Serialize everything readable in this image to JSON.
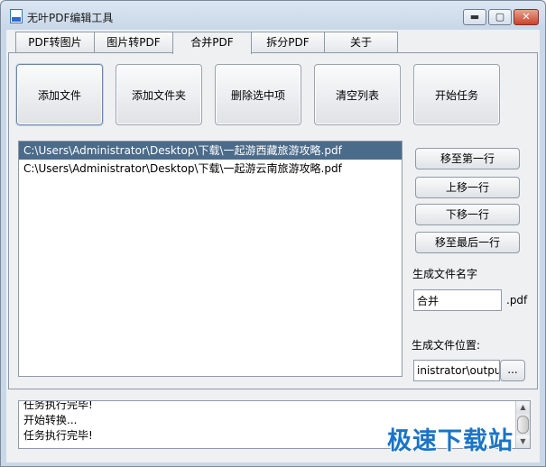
{
  "window": {
    "title": "无叶PDF编辑工具",
    "controls": {
      "minimize": "▬",
      "maximize": "▢",
      "close": "✕"
    }
  },
  "tabs": [
    {
      "label": "PDF转图片",
      "active": false
    },
    {
      "label": "图片转PDF",
      "active": false
    },
    {
      "label": "合并PDF",
      "active": true
    },
    {
      "label": "拆分PDF",
      "active": false
    },
    {
      "label": "关于",
      "active": false
    }
  ],
  "toolbar": {
    "add_file": "添加文件",
    "add_folder": "添加文件夹",
    "delete_selected": "删除选中项",
    "clear_list": "清空列表",
    "start_task": "开始任务"
  },
  "files": [
    {
      "path": "C:\\Users\\Administrator\\Desktop\\下载\\一起游西藏旅游攻略.pdf",
      "selected": true
    },
    {
      "path": "C:\\Users\\Administrator\\Desktop\\下载\\一起游云南旅游攻略.pdf",
      "selected": false
    }
  ],
  "move": {
    "to_first": "移至第一行",
    "up": "上移一行",
    "down": "下移一行",
    "to_last": "移至最后一行"
  },
  "output": {
    "name_label": "生成文件名字",
    "name_value": "合并",
    "ext": ".pdf",
    "location_label": "生成文件位置:",
    "location_value": "inistrator\\output",
    "browse_label": "..."
  },
  "log": [
    "任务执行完毕!",
    "开始转换...",
    "任务执行完毕!"
  ],
  "watermark": "极速下载站"
}
